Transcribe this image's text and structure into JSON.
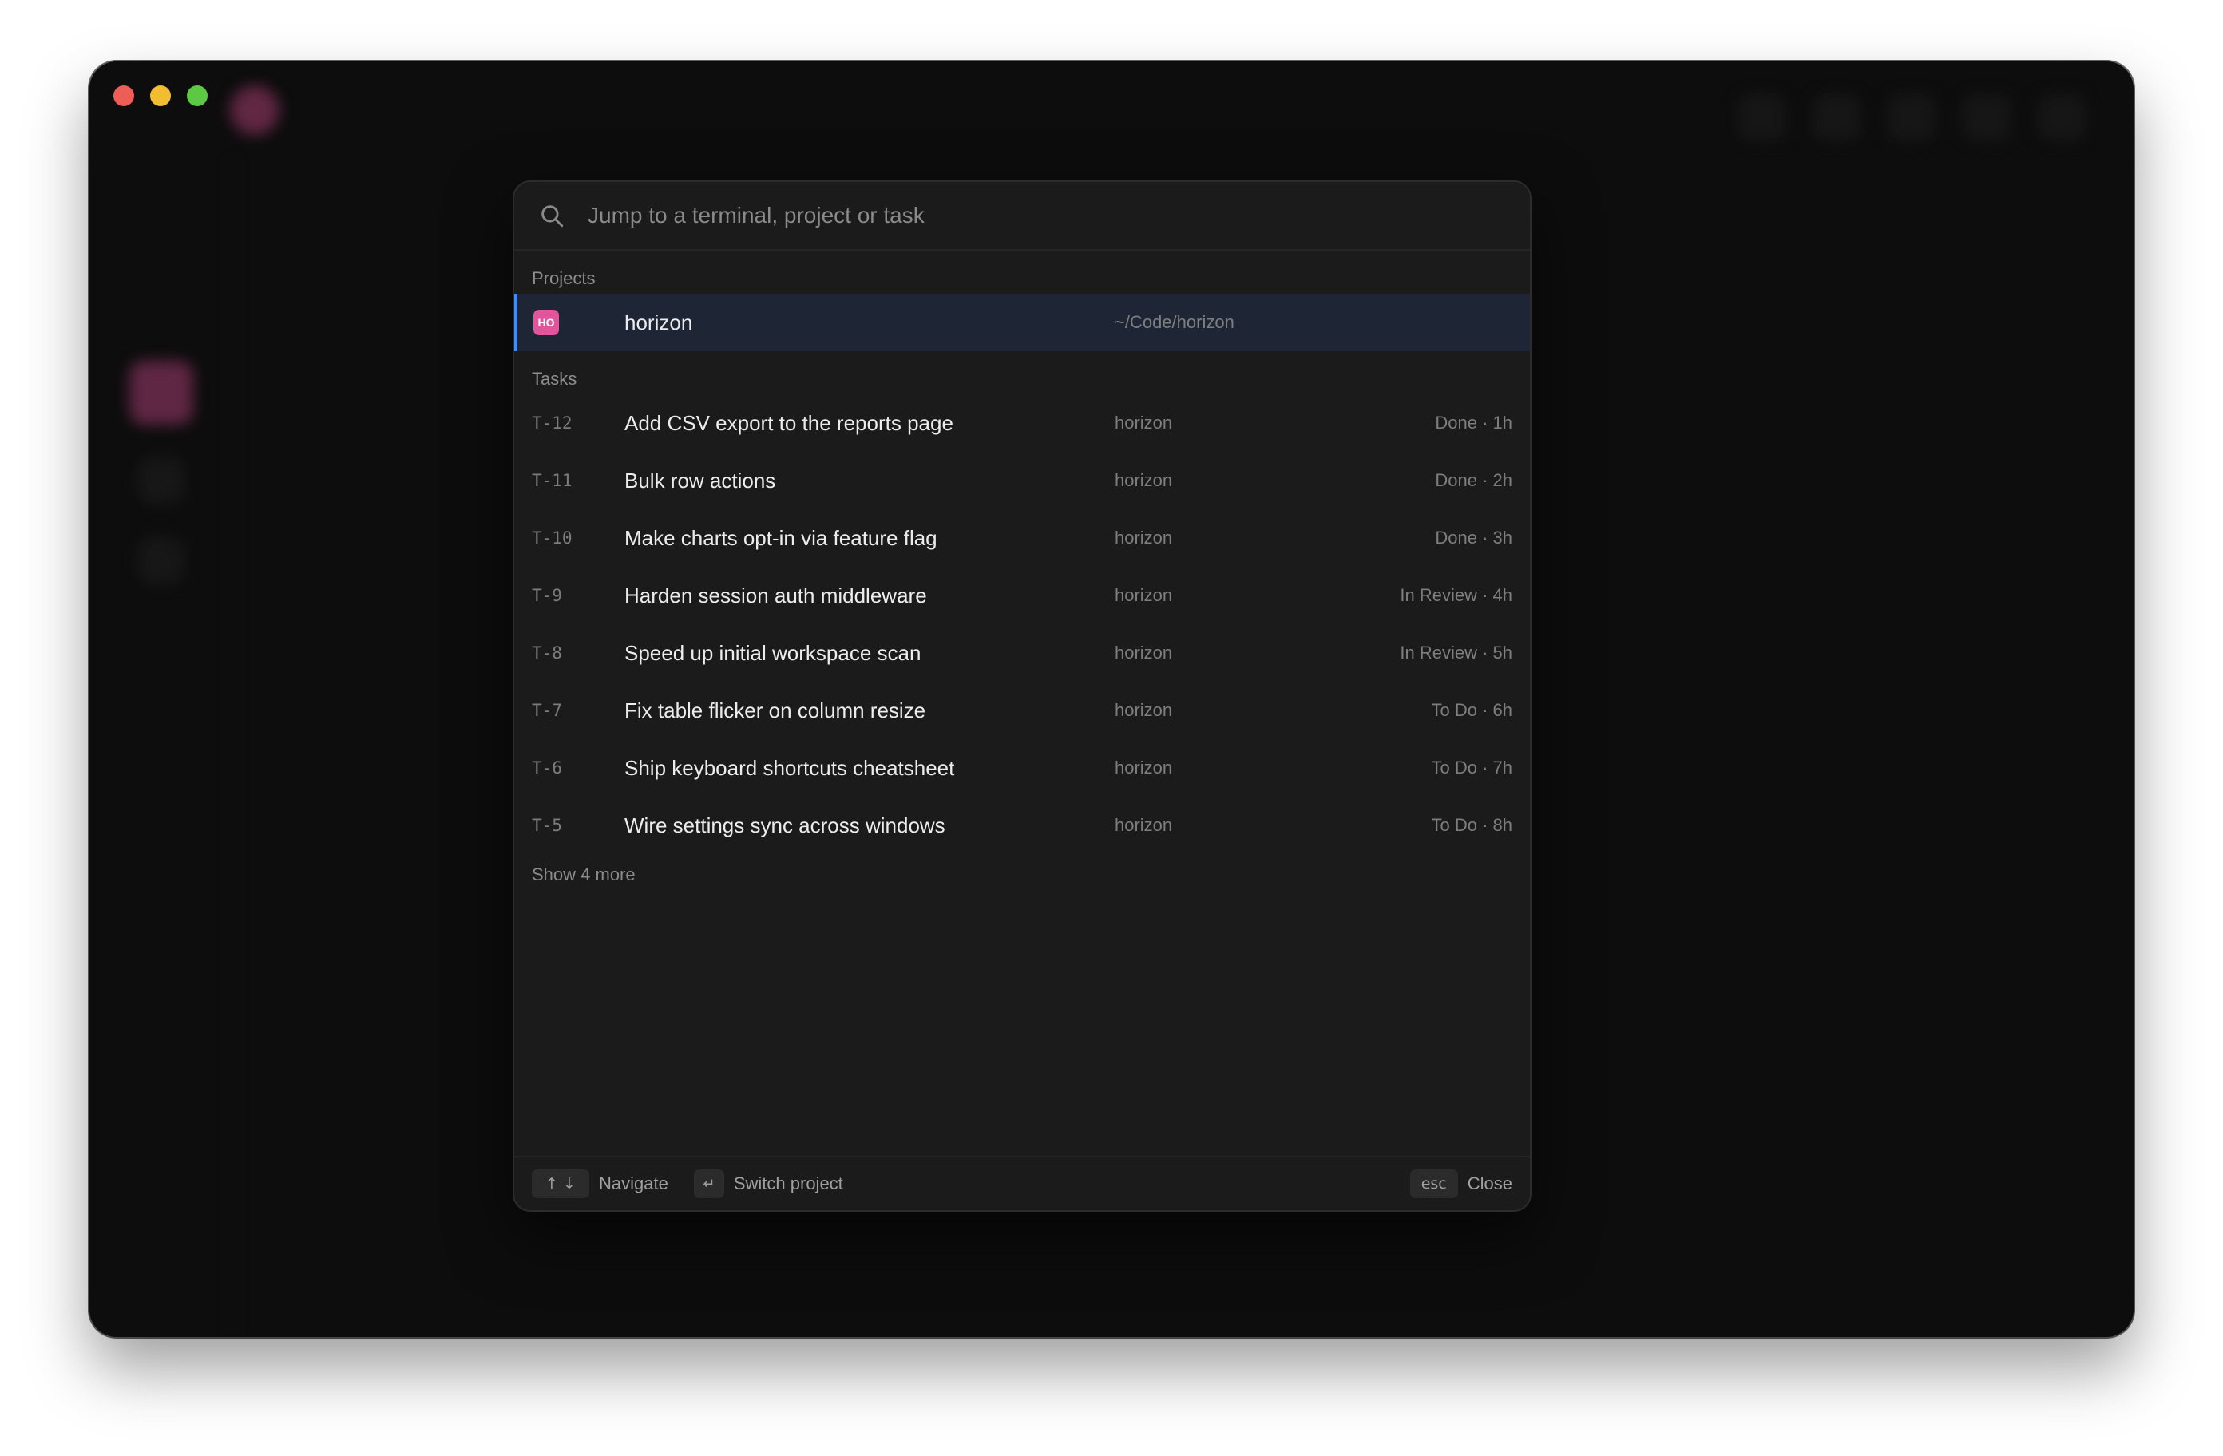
{
  "search": {
    "placeholder": "Jump to a terminal, project or task"
  },
  "sections": {
    "projects_label": "Projects",
    "tasks_label": "Tasks"
  },
  "projects": [
    {
      "badge": "HO",
      "name": "horizon",
      "path": "~/Code/horizon",
      "badge_color": "#e2559c",
      "selected": true
    }
  ],
  "tasks": [
    {
      "id": "T-12",
      "title": "Add CSV export to the reports page",
      "project": "horizon",
      "status": "Done · 1h"
    },
    {
      "id": "T-11",
      "title": "Bulk row actions",
      "project": "horizon",
      "status": "Done · 2h"
    },
    {
      "id": "T-10",
      "title": "Make charts opt-in via feature flag",
      "project": "horizon",
      "status": "Done · 3h"
    },
    {
      "id": "T-9",
      "title": "Harden session auth middleware",
      "project": "horizon",
      "status": "In Review · 4h"
    },
    {
      "id": "T-8",
      "title": "Speed up initial workspace scan",
      "project": "horizon",
      "status": "In Review · 5h"
    },
    {
      "id": "T-7",
      "title": "Fix table flicker on column resize",
      "project": "horizon",
      "status": "To Do · 6h"
    },
    {
      "id": "T-6",
      "title": "Ship keyboard shortcuts cheatsheet",
      "project": "horizon",
      "status": "To Do · 7h"
    },
    {
      "id": "T-5",
      "title": "Wire settings sync across windows",
      "project": "horizon",
      "status": "To Do · 8h"
    }
  ],
  "show_more": "Show 4 more",
  "footer": {
    "navigate_key": "↑ ↓",
    "navigate_label": "Navigate",
    "switch_key": "↵",
    "switch_label": "Switch project",
    "close_key": "esc",
    "close_label": "Close"
  },
  "colors": {
    "accent": "#3e8ef7",
    "selected_row": "#1e2636",
    "project_badge": "#e2559c"
  }
}
